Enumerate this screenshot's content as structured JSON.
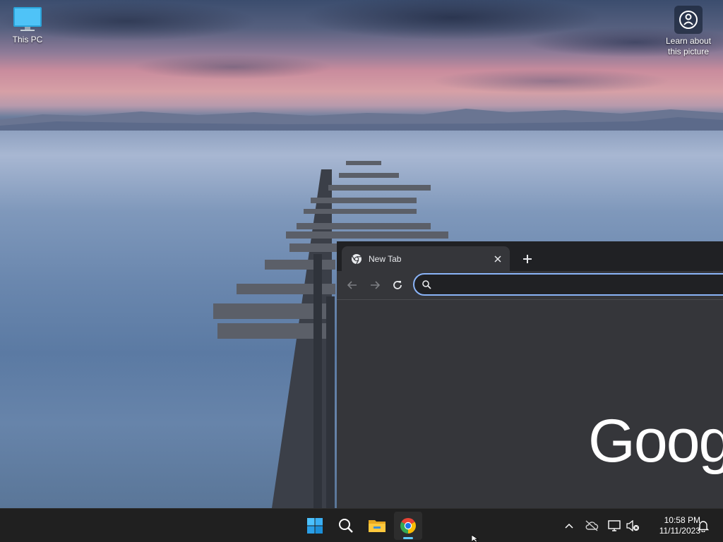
{
  "desktop": {
    "icons": [
      {
        "label": "This PC",
        "icon": "monitor-icon"
      },
      {
        "label": "Learn about this picture",
        "icon": "camera-aperture-icon"
      }
    ]
  },
  "browser": {
    "tab": {
      "title": "New Tab",
      "favicon": "chrome-icon"
    },
    "omnibox": {
      "value": "",
      "placeholder": ""
    },
    "logo_text": "Goog",
    "colors": {
      "accent": "#8ab4f8",
      "frame": "#202124",
      "toolbar": "#35363a"
    }
  },
  "taskbar": {
    "apps": [
      {
        "name": "Start",
        "icon": "windows-start-icon"
      },
      {
        "name": "Search",
        "icon": "search-icon"
      },
      {
        "name": "File Explorer",
        "icon": "folder-icon"
      },
      {
        "name": "Google Chrome",
        "icon": "chrome-icon",
        "active": true
      }
    ],
    "tray": {
      "icons": [
        "chevron-up-icon",
        "cloud-off-icon",
        "network-icon",
        "volume-muted-icon",
        "notification-bell-icon"
      ]
    },
    "clock": {
      "time": "10:58 PM",
      "date": "11/11/2023"
    }
  }
}
